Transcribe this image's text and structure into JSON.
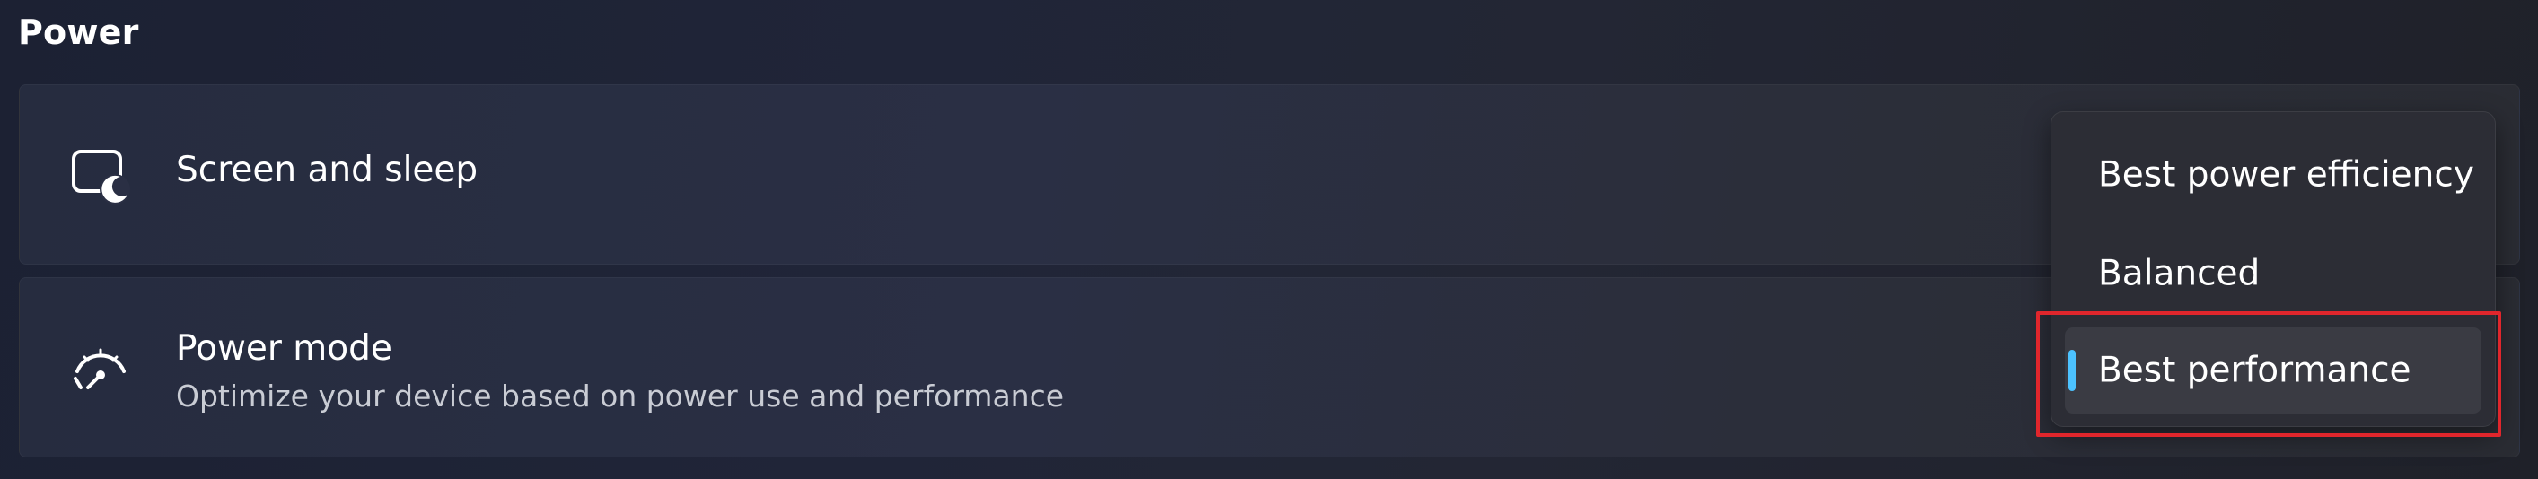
{
  "section": {
    "title": "Power"
  },
  "cards": {
    "screen_sleep": {
      "icon": "screen-sleep-icon",
      "title": "Screen and sleep"
    },
    "power_mode": {
      "icon": "power-mode-gauge-icon",
      "title": "Power mode",
      "description": "Optimize your device based on power use and performance"
    }
  },
  "power_mode_menu": {
    "options": [
      {
        "label": "Best power efficiency"
      },
      {
        "label": "Balanced"
      },
      {
        "label": "Best performance"
      }
    ],
    "selected": "Best performance"
  },
  "colors": {
    "accent": "#4cc2ff",
    "highlight_outline": "#e0262c"
  }
}
